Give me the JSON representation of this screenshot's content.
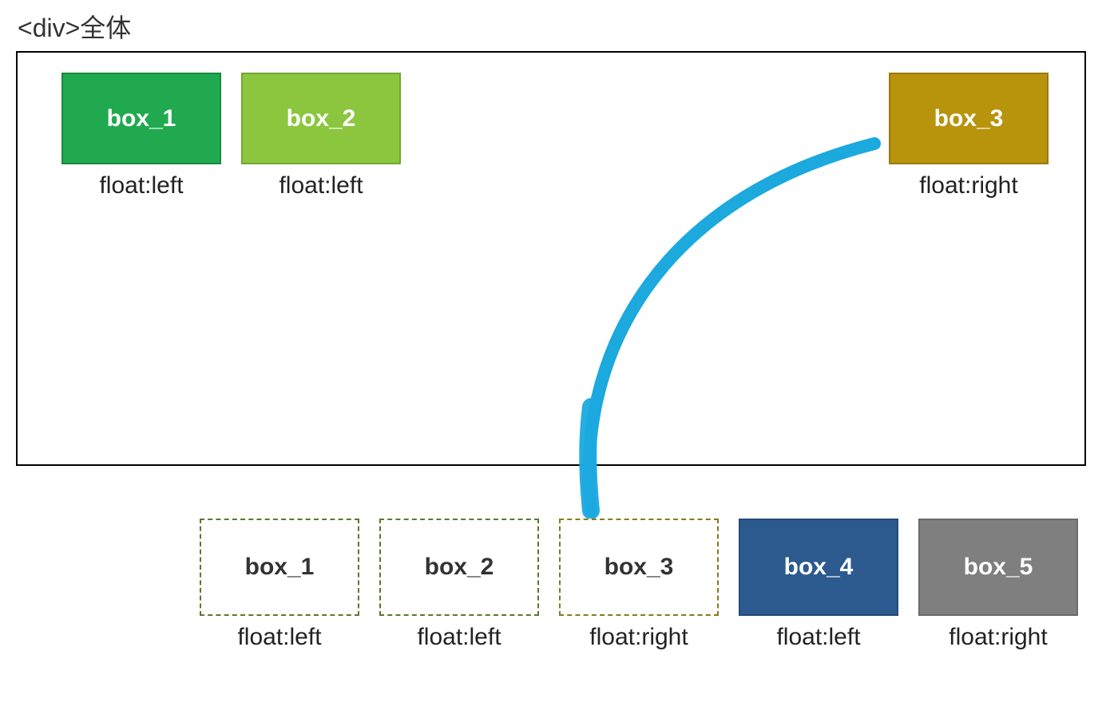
{
  "title": "<div>全体",
  "top_boxes": {
    "box1": {
      "label": "box_1",
      "caption": "float:left",
      "bg": "#21a94f"
    },
    "box2": {
      "label": "box_2",
      "caption": "float:left",
      "bg": "#8cc63f"
    },
    "box3": {
      "label": "box_3",
      "caption": "float:right",
      "bg": "#b8930c"
    }
  },
  "bottom_boxes": [
    {
      "label": "box_1",
      "caption": "float:left",
      "style": "dashed-green"
    },
    {
      "label": "box_2",
      "caption": "float:left",
      "style": "dashed-green"
    },
    {
      "label": "box_3",
      "caption": "float:right",
      "style": "dashed-olive"
    },
    {
      "label": "box_4",
      "caption": "float:left",
      "style": "solid-blue"
    },
    {
      "label": "box_5",
      "caption": "float:right",
      "style": "solid-gray"
    }
  ],
  "arrow_color": "#1ba9de"
}
